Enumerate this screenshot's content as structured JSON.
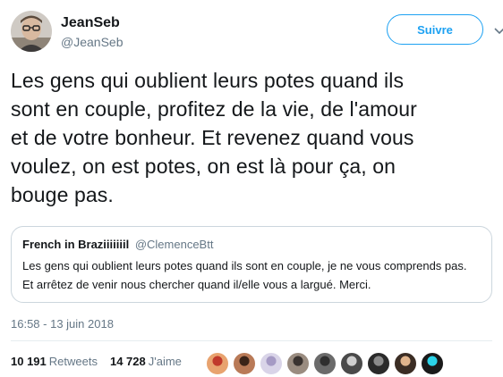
{
  "author": {
    "name": "JeanSeb",
    "handle": "@JeanSeb",
    "avatar_icon": "avatar-man-glasses"
  },
  "follow_label": "Suivre",
  "tweet_lines": [
    "Les gens qui oublient leurs potes quand ils",
    "sont en couple, profitez de la vie, de l'amour",
    "et de votre bonheur. Et revenez quand vous",
    "voulez, on est potes, on est là pour ça, on",
    "bouge pas."
  ],
  "quoted": {
    "name": "French in Braziiiiiiil",
    "handle": "@ClemenceBtt",
    "lines": [
      "Les gens qui oublient leurs potes quand ils sont en couple, je ne vous comprends pas.",
      "Et arrêtez de venir nous chercher quand il/elle vous a largué. Merci."
    ]
  },
  "timestamp": "16:58 - 13 juin 2018",
  "stats": {
    "retweets_count": "10 191",
    "retweets_label": "Retweets",
    "likes_count": "14 728",
    "likes_label": "J'aime"
  },
  "liker_avatars": [
    {
      "color": "#e8a36f",
      "accent": "#c0392b"
    },
    {
      "color": "#b97a57",
      "accent": "#3b2418"
    },
    {
      "color": "#d9d4e8",
      "accent": "#a59ac4"
    },
    {
      "color": "#9a8c80",
      "accent": "#3a3330"
    },
    {
      "color": "#6b6b6b",
      "accent": "#2f2f2f"
    },
    {
      "color": "#4a4a4a",
      "accent": "#cfcfcf"
    },
    {
      "color": "#2a2a2a",
      "accent": "#8a8a8a"
    },
    {
      "color": "#3b2d24",
      "accent": "#e0b48c"
    },
    {
      "color": "#1a1a1a",
      "accent": "#2bd3e8"
    }
  ],
  "colors": {
    "accent": "#1da1f2",
    "secondary_text": "#657786",
    "border": "#ccd6dd"
  }
}
